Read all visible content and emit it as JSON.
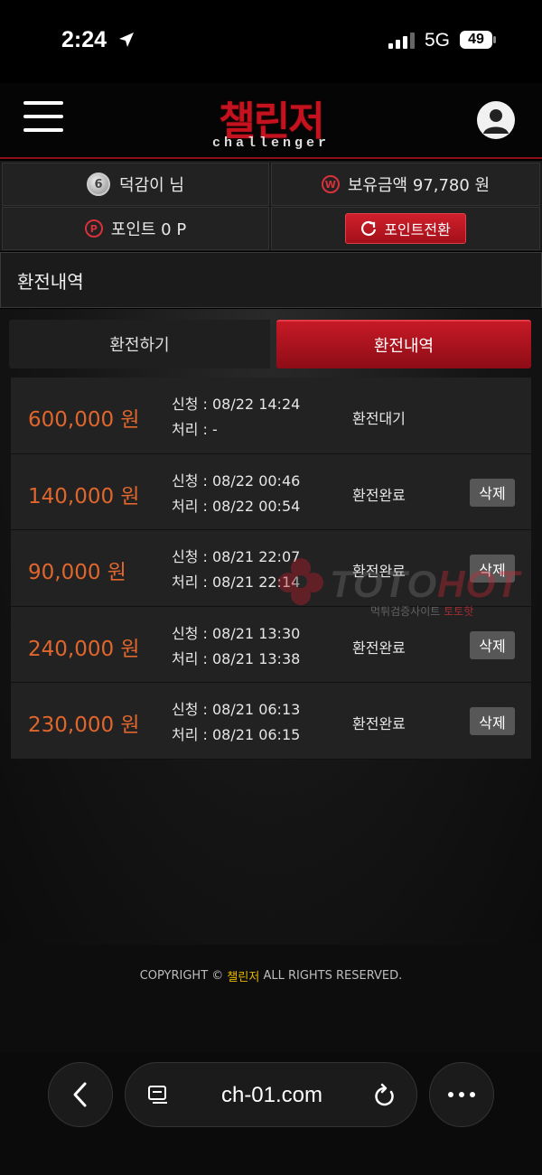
{
  "status_bar": {
    "time": "2:24",
    "network": "5G",
    "battery": "49"
  },
  "header": {
    "logo_korean": "챌린저",
    "logo_english": "challenger"
  },
  "info": {
    "level": "6",
    "username": "덕감이 님",
    "balance_icon": "W",
    "balance": "보유금액 97,780 원",
    "point_icon": "P",
    "points": "포인트 0 P",
    "convert_button": "포인트전환"
  },
  "page_title": "환전내역",
  "tabs": [
    {
      "label": "환전하기",
      "active": false
    },
    {
      "label": "환전내역",
      "active": true
    }
  ],
  "history": [
    {
      "amount": "600,000 원",
      "requested": "신청 : 08/22 14:24",
      "processed": "처리 : -",
      "status": "환전대기",
      "delete": ""
    },
    {
      "amount": "140,000 원",
      "requested": "신청 : 08/22 00:46",
      "processed": "처리 : 08/22 00:54",
      "status": "환전완료",
      "delete": "삭제"
    },
    {
      "amount": "90,000 원",
      "requested": "신청 : 08/21 22:07",
      "processed": "처리 : 08/21 22:14",
      "status": "환전완료",
      "delete": "삭제"
    },
    {
      "amount": "240,000 원",
      "requested": "신청 : 08/21 13:30",
      "processed": "처리 : 08/21 13:38",
      "status": "환전완료",
      "delete": "삭제"
    },
    {
      "amount": "230,000 원",
      "requested": "신청 : 08/21 06:13",
      "processed": "처리 : 08/21 06:15",
      "status": "환전완료",
      "delete": "삭제"
    }
  ],
  "watermark": {
    "toto": "TOTO",
    "hot": "HOT",
    "sub_text": "먹튀검증사이트",
    "sub_brand": "토토핫"
  },
  "footer": {
    "prefix": "COPYRIGHT ©",
    "brand": "챌린저",
    "suffix": "ALL RIGHTS RESERVED."
  },
  "browser": {
    "url": "ch-01.com"
  },
  "colors": {
    "accent_red": "#c61a26",
    "amount_orange": "#e0662d",
    "brand_gold": "#e5b700"
  }
}
